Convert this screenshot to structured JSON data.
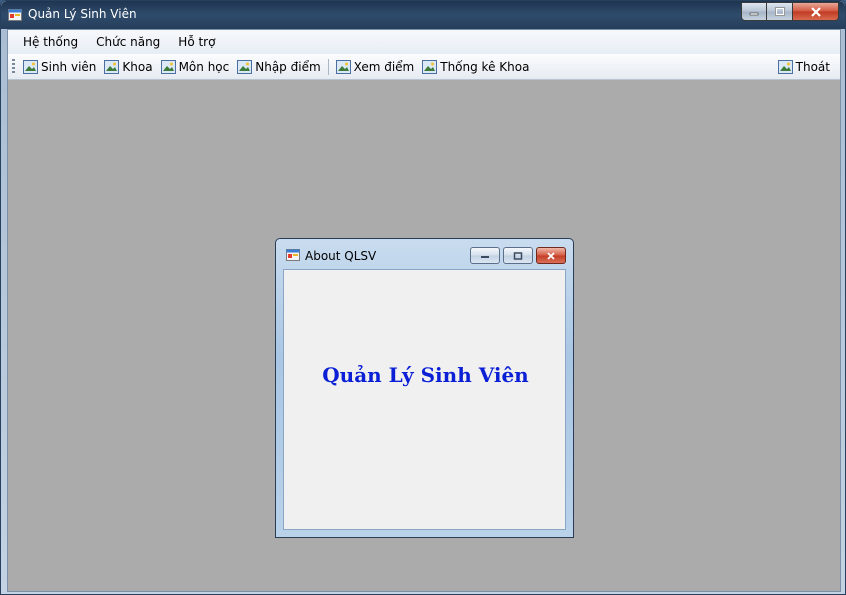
{
  "window": {
    "title": "Quản Lý Sinh Viên"
  },
  "menu": [
    {
      "label": "Hệ thống"
    },
    {
      "label": "Chức năng"
    },
    {
      "label": "Hỗ trợ"
    }
  ],
  "toolbar": {
    "items": [
      {
        "label": "Sinh viên",
        "icon": "image-icon"
      },
      {
        "label": "Khoa",
        "icon": "image-icon"
      },
      {
        "label": "Môn học",
        "icon": "image-icon"
      },
      {
        "label": "Nhập điểm",
        "icon": "image-icon"
      },
      {
        "label": "Xem điểm",
        "icon": "image-icon"
      },
      {
        "label": "Thống kê Khoa",
        "icon": "image-icon"
      }
    ],
    "exit_label": "Thoát"
  },
  "about_dialog": {
    "title": "About QLSV",
    "heading": "Quản Lý Sinh Viên",
    "heading_color": "#0b1fd6"
  },
  "colors": {
    "mdi_background": "#ababab",
    "titlebar": "#2f4b6c",
    "close_button": "#c03a22"
  }
}
